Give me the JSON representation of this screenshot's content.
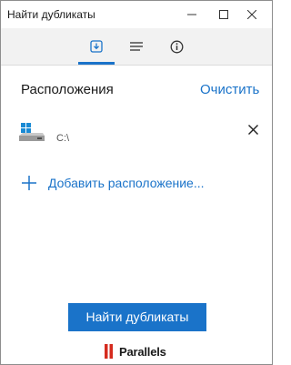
{
  "window": {
    "title": "Найти дубликаты"
  },
  "toolbar": {
    "tabs": [
      {
        "icon": "import-icon",
        "active": true
      },
      {
        "icon": "list-icon",
        "active": false
      },
      {
        "icon": "info-icon",
        "active": false
      }
    ]
  },
  "locations": {
    "heading": "Расположения",
    "clear_label": "Очистить",
    "items": [
      {
        "label": "C:\\",
        "icon": "hard-drive-icon"
      }
    ],
    "add_label": "Добавить расположение..."
  },
  "action": {
    "find_label": "Найти дубликаты"
  },
  "footer": {
    "logo_text": "Parallels"
  },
  "colors": {
    "accent": "#1a73c9",
    "logo_red": "#d52b1e"
  }
}
